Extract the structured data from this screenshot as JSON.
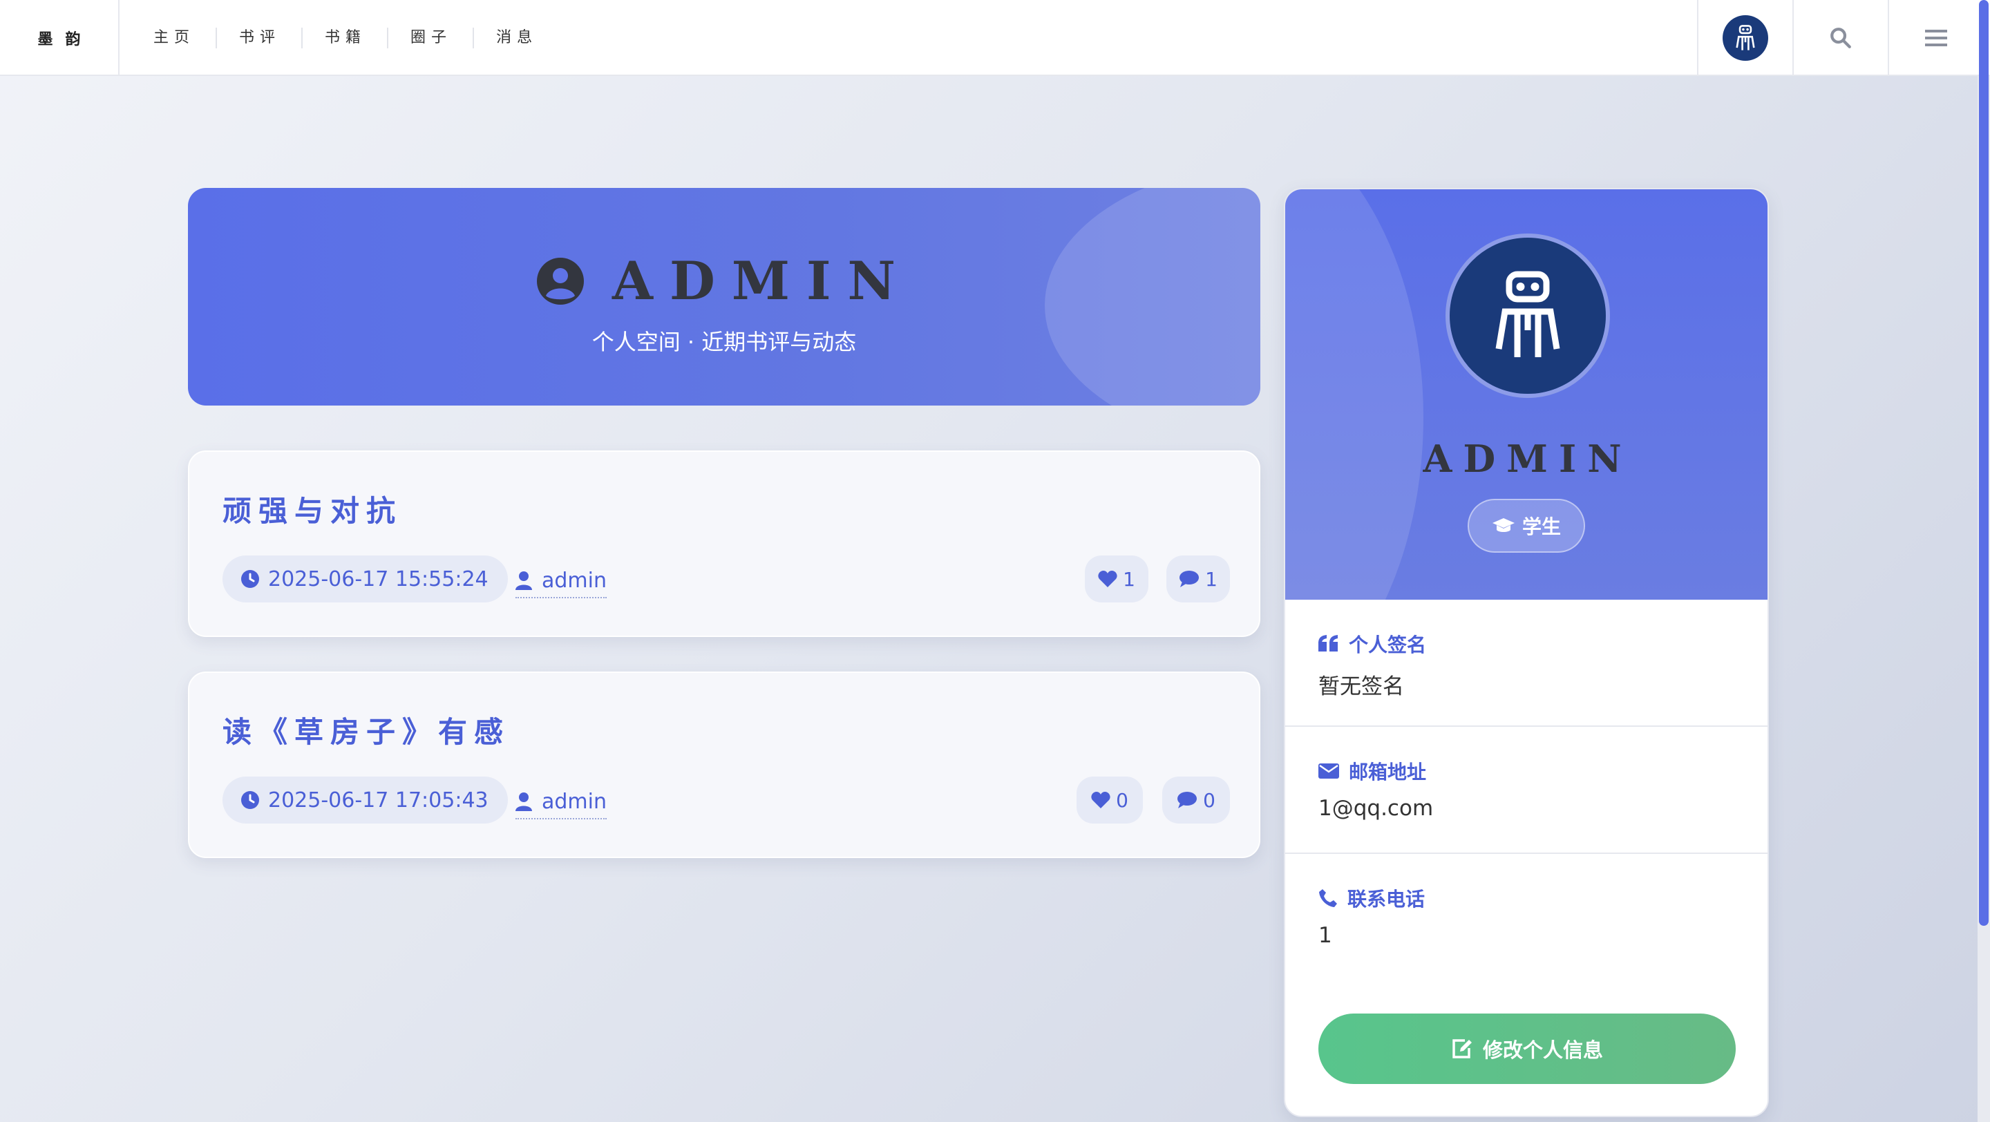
{
  "brand": "墨韵",
  "nav": {
    "items": [
      {
        "label": "主页"
      },
      {
        "label": "书评"
      },
      {
        "label": "书籍"
      },
      {
        "label": "圈子"
      },
      {
        "label": "消息"
      }
    ]
  },
  "topbar_icons": [
    "user-avatar-icon",
    "search-icon",
    "menu-icon"
  ],
  "banner": {
    "name": "ADMIN",
    "subtitle": "个人空间 · 近期书评与动态"
  },
  "posts": [
    {
      "title": "顽强与对抗",
      "time": "2025-06-17 15:55:24",
      "author": "admin",
      "likes": "1",
      "comments": "1"
    },
    {
      "title": "读《草房子》有感",
      "time": "2025-06-17 17:05:43",
      "author": "admin",
      "likes": "0",
      "comments": "0"
    }
  ],
  "profile": {
    "name": "ADMIN",
    "role": "学生",
    "signature_label": "个人签名",
    "signature_value": "暂无签名",
    "email_label": "邮箱地址",
    "email_value": "1@qq.com",
    "phone_label": "联系电话",
    "phone_value": "1",
    "edit_button": "修改个人信息"
  },
  "colors": {
    "accent": "#4a5fd6",
    "banner": "#5a6fe8",
    "avatar_bg": "#1a3a7a",
    "edit_button": "#5ec48a"
  }
}
